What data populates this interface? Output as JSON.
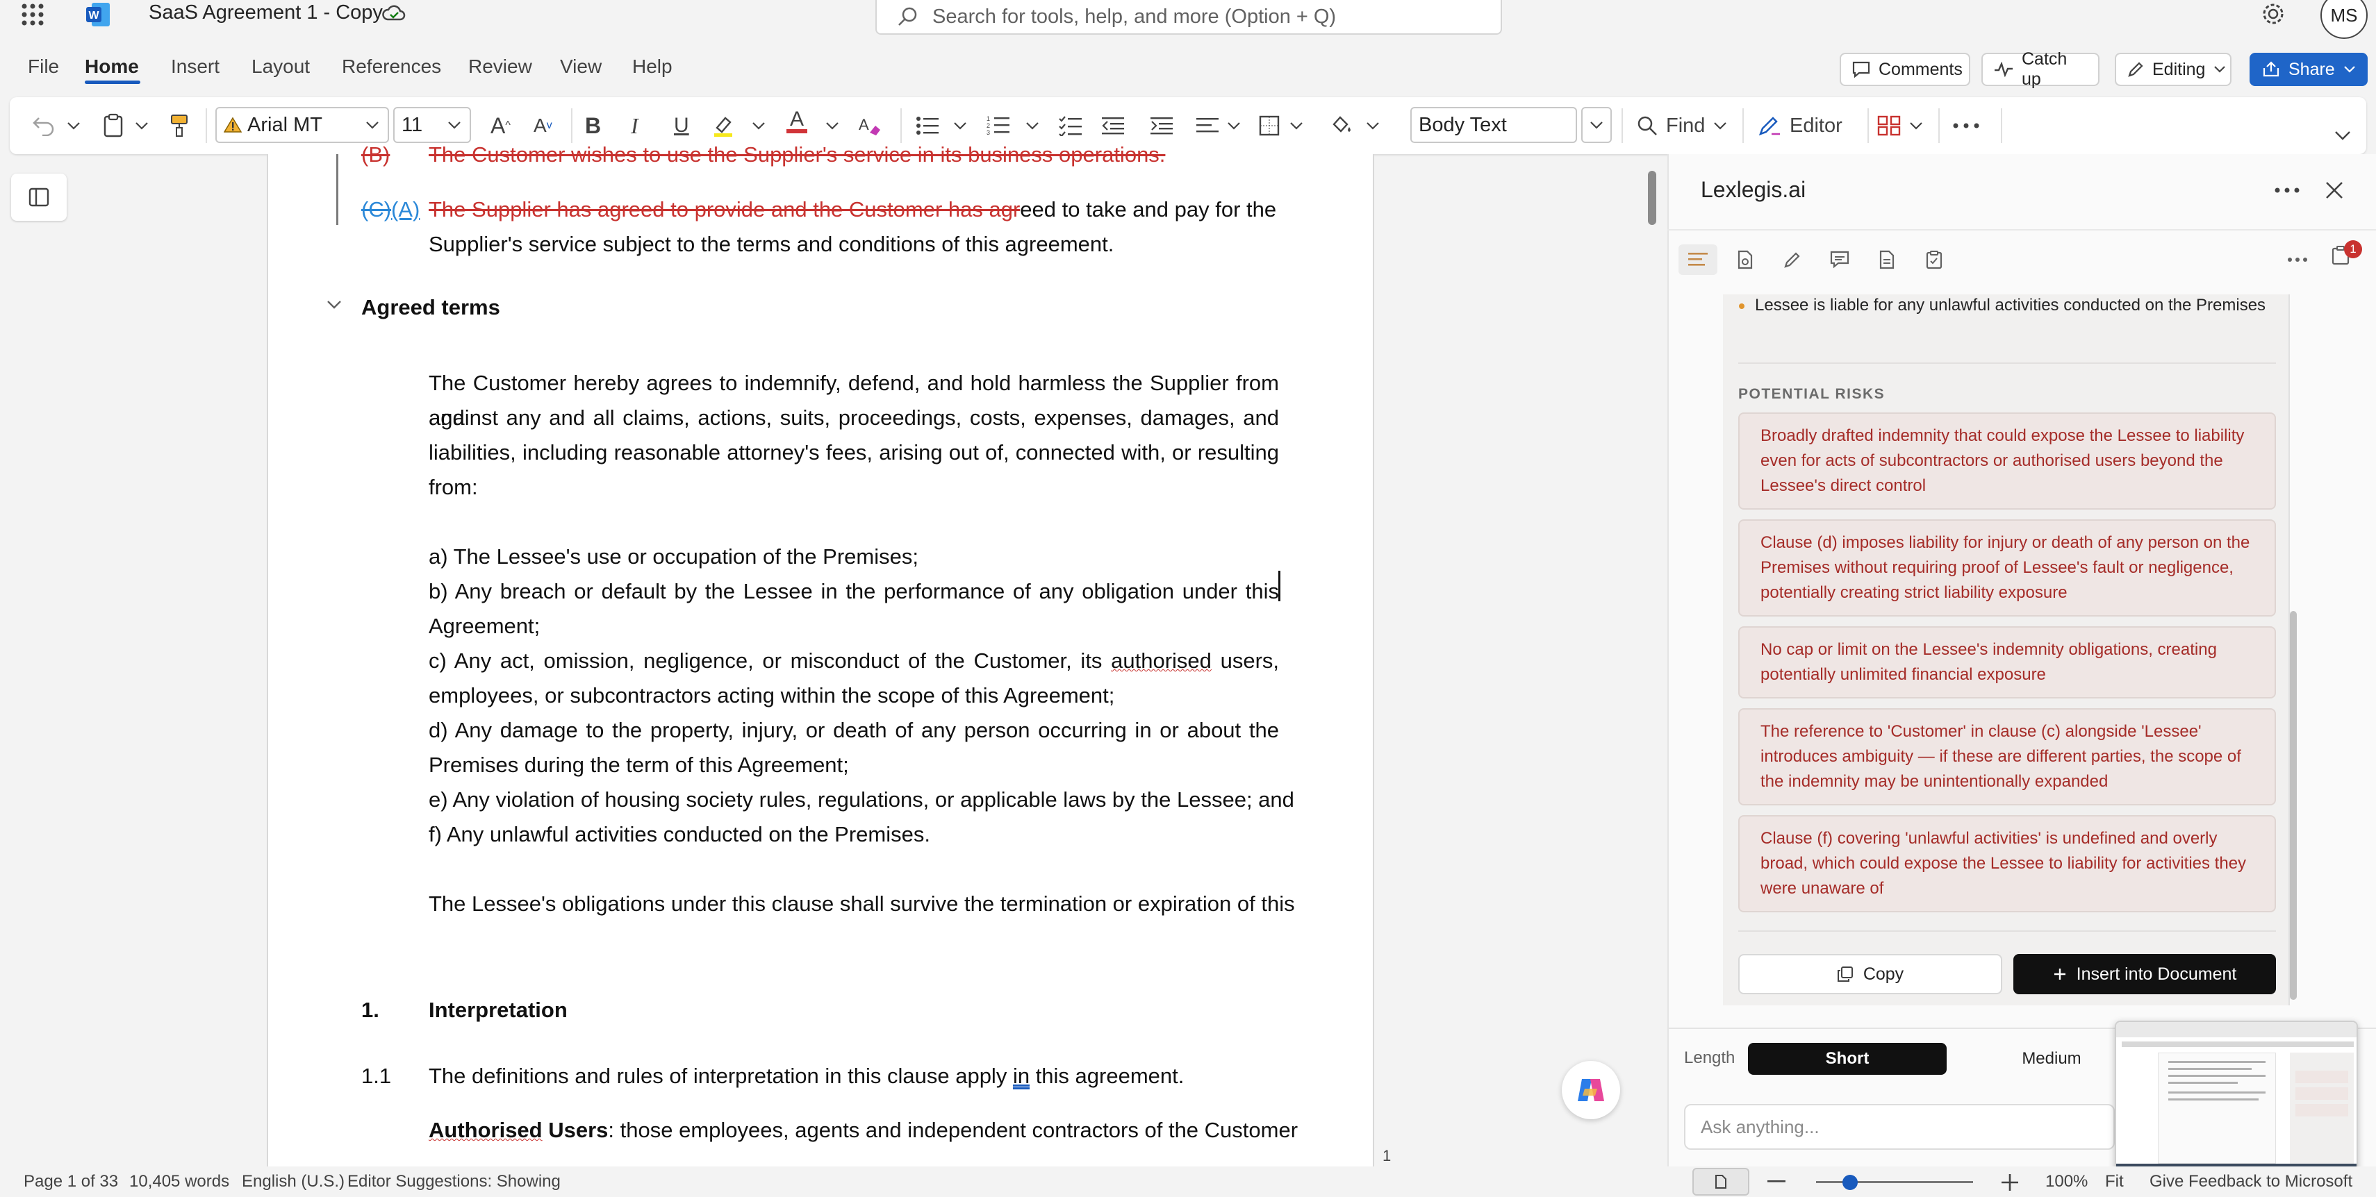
{
  "titlebar": {
    "doc_title": "SaaS Agreement 1 - Copy",
    "search_placeholder": "Search for tools, help, and more (Option + Q)",
    "avatar_initials": "MS"
  },
  "menu": {
    "items": [
      "File",
      "Home",
      "Insert",
      "Layout",
      "References",
      "Review",
      "View",
      "Help"
    ],
    "active": "Home",
    "comments": "Comments",
    "catch_up": "Catch up",
    "editing": "Editing",
    "share": "Share"
  },
  "ribbon": {
    "font_name": "Arial MT",
    "font_size": "11",
    "style": "Body Text",
    "find": "Find",
    "editor": "Editor"
  },
  "document": {
    "recital_b_num": "(B)",
    "recital_b_text": "The Customer wishes to use the Supplier's service in its business operations.",
    "recital_c_num_deleted": "(C)",
    "recital_c_num_inserted": "(A)",
    "recital_c_deleted": "The Supplier has agreed to provide and the Customer has agr",
    "recital_c_rest": "eed to take and pay for the",
    "recital_c_line2": "Supplier's service subject to the terms and conditions of this agreement.",
    "agreed_terms": "Agreed terms",
    "indemnity_lines": [
      "The Customer hereby agrees to indemnify, defend, and hold harmless the Supplier from and",
      "against any and all claims, actions, suits, proceedings, costs, expenses, damages, and",
      "liabilities, including reasonable attorney's fees, arising out of, connected with, or resulting",
      "from:"
    ],
    "item_a": "a) The Lessee's use or occupation of the Premises;",
    "item_b_line1": "b) Any breach or default by the Lessee in the performance of any obligation under this",
    "item_b_line2": "Agreement;",
    "item_c_line1_pre": "c) Any act, omission, negligence, or misconduct of the Customer, its ",
    "item_c_line1_word": "authorised",
    "item_c_line1_post": " users,",
    "item_c_line2": "employees, or subcontractors acting within the scope of this Agreement;",
    "item_d_line1": "d) Any damage to the property, injury, or death of any person occurring in or about the",
    "item_d_line2": "Premises during the term of this Agreement;",
    "item_e": "e) Any violation of housing society rules, regulations, or applicable laws by the Lessee; and",
    "item_f": "f) Any unlawful activities conducted on the Premises.",
    "survive": "The Lessee's obligations under this clause shall survive the termination or expiration of this",
    "interp_num": "1.",
    "interp_title": "Interpretation",
    "clause_11_num": "1.1",
    "clause_11_pre": "The definitions and rules of interpretation in this clause apply ",
    "clause_11_word": "in",
    "clause_11_post": " this agreement.",
    "auth_users_word": "Authorised",
    "auth_users_bold": " Users",
    "auth_users_rest": ": those employees, agents and independent contractors of the Customer",
    "page_marker": "1"
  },
  "panel": {
    "title": "Lexlegis.ai",
    "notification_count": "1",
    "bullet_text": "Lessee is liable for any unlawful activities conducted on the Premises",
    "risks_heading": "POTENTIAL RISKS",
    "risks": [
      "Broadly drafted indemnity that could expose the Lessee to liability even for acts of subcontractors or authorised users beyond the Lessee's direct control",
      "Clause (d) imposes liability for injury or death of any person on the Premises without requiring proof of Lessee's fault or negligence, potentially creating strict liability exposure",
      "No cap or limit on the Lessee's indemnity obligations, creating potentially unlimited financial exposure",
      "The reference to 'Customer' in clause (c) alongside 'Lessee' introduces ambiguity — if these are different parties, the scope of the indemnity may be unintentionally expanded",
      "Clause (f) covering 'unlawful activities' is undefined and overly broad, which could expose the Lessee to liability for activities they were unaware of"
    ],
    "copy_label": "Copy",
    "insert_label": "Insert into Document",
    "length_label": "Length",
    "length_options": [
      "Short",
      "Medium"
    ],
    "length_selected": "Short",
    "ask_placeholder": "Ask anything..."
  },
  "statusbar": {
    "page": "Page 1 of 33",
    "words": "10,405 words",
    "language": "English (U.S.)",
    "editor_suggestions": "Editor Suggestions: Showing",
    "zoom": "100%",
    "fit": "Fit",
    "feedback": "Give Feedback to Microsoft"
  },
  "colors": {
    "accent": "#185abd",
    "deletion": "#c8322f",
    "risk_bg": "#efe6e4",
    "risk_text": "#a52c28"
  }
}
